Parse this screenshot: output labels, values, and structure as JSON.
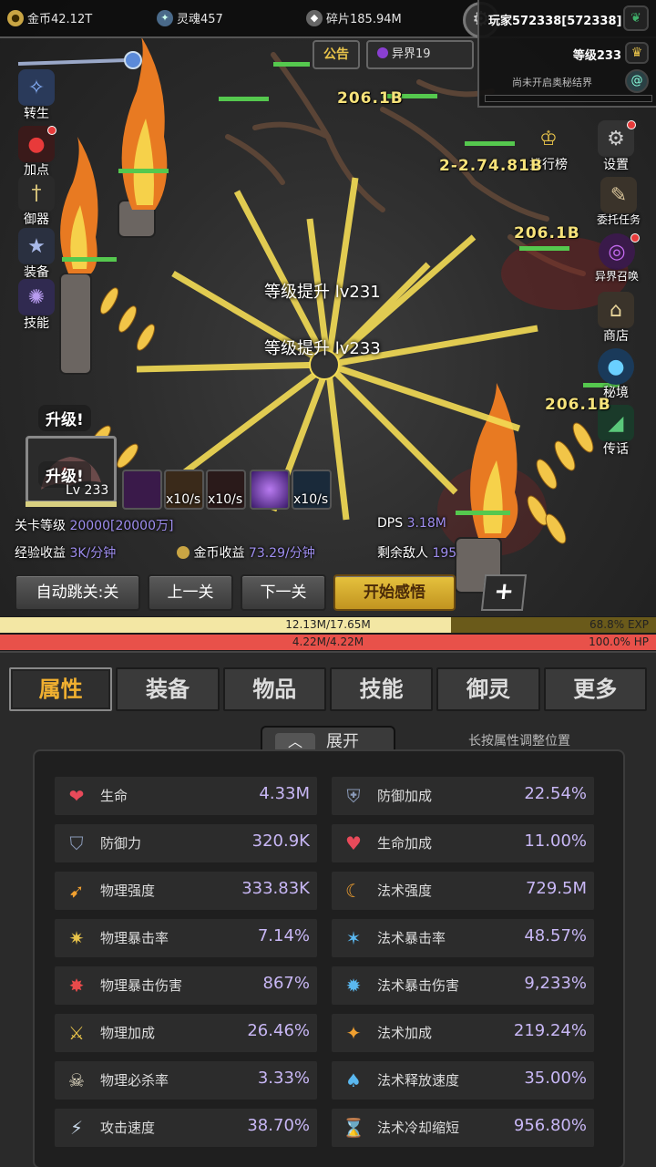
{
  "resources": {
    "gold": "金币42.12T",
    "soul": "灵魂457",
    "shards": "碎片185.94M"
  },
  "player": {
    "name": "玩家572338[572338]",
    "level": "等级233",
    "secret_realm": "尚未开启奥秘结界"
  },
  "notice_label": "公告",
  "realm_label": "异界19",
  "left_menu": [
    {
      "label": "转生",
      "icon": "rebirth-icon"
    },
    {
      "label": "加点",
      "icon": "blood-drop-icon"
    },
    {
      "label": "御器",
      "icon": "sword-icon"
    },
    {
      "label": "装备",
      "icon": "star-badge-icon"
    },
    {
      "label": "技能",
      "icon": "spellbook-icon"
    }
  ],
  "right_menu": [
    {
      "label": "排行榜",
      "icon": "trophy-icon"
    },
    {
      "label": "设置",
      "icon": "gear-icon"
    },
    {
      "label": "委托任务",
      "icon": "scroll-icon"
    },
    {
      "label": "异界召唤",
      "icon": "portal-icon"
    },
    {
      "label": "商店",
      "icon": "shop-bag-icon"
    },
    {
      "label": "秘境",
      "icon": "orb-icon"
    },
    {
      "label": "传话",
      "icon": "horn-icon"
    }
  ],
  "level_up_messages": [
    "等级提升 lv231",
    "等级提升 lv233"
  ],
  "floating_numbers": [
    "206.1B",
    "2-2.74.81B",
    "206.1B",
    "206.1B"
  ],
  "character": {
    "level": "Lv 233",
    "upgrade_1": "升级!",
    "upgrade_2": "升级!"
  },
  "skill_rates": [
    "x10/s",
    "x10/s",
    "x10/s"
  ],
  "stage_info": {
    "stage_label": "关卡等级",
    "stage_value": "20000[20000万]",
    "dps_label": "DPS",
    "dps_value": "3.18M",
    "exp_label": "经验收益",
    "exp_value": "3K/分钟",
    "gold_label": "金币收益",
    "gold_value": "73.29/分钟",
    "enemies_label": "剩余敌人",
    "enemies_value": "195"
  },
  "buttons": {
    "auto_skip": "自动跳关:关",
    "prev": "上一关",
    "next": "下一关",
    "start": "开始感悟",
    "plus": "+"
  },
  "exp_bar": {
    "text": "12.13M/17.65M",
    "percent": "68.8% EXP",
    "fill": 0.688
  },
  "hp_bar": {
    "text": "4.22M/4.22M",
    "percent": "100.0% HP",
    "fill": 1.0
  },
  "tabs": [
    "属性",
    "装备",
    "物品",
    "技能",
    "御灵",
    "更多"
  ],
  "expand_label": "展开",
  "hint": "长按属性调整位置",
  "stats": [
    {
      "name": "生命",
      "value": "4.33M",
      "icon": "heart-icon"
    },
    {
      "name": "防御加成",
      "value": "22.54%",
      "icon": "shield-plus-icon"
    },
    {
      "name": "防御力",
      "value": "320.9K",
      "icon": "shield-icon"
    },
    {
      "name": "生命加成",
      "value": "11.00%",
      "icon": "heart-plus-icon"
    },
    {
      "name": "物理强度",
      "value": "333.83K",
      "icon": "spear-icon"
    },
    {
      "name": "法术强度",
      "value": "729.5M",
      "icon": "moon-staff-icon"
    },
    {
      "name": "物理暴击率",
      "value": "7.14%",
      "icon": "crit-sword-icon"
    },
    {
      "name": "法术暴击率",
      "value": "48.57%",
      "icon": "crit-magic-icon"
    },
    {
      "name": "物理暴击伤害",
      "value": "867%",
      "icon": "crit-damage-icon"
    },
    {
      "name": "法术暴击伤害",
      "value": "9,233%",
      "icon": "magic-damage-icon"
    },
    {
      "name": "物理加成",
      "value": "26.46%",
      "icon": "sword-plus-icon"
    },
    {
      "name": "法术加成",
      "value": "219.24%",
      "icon": "magic-plus-icon"
    },
    {
      "name": "物理必杀率",
      "value": "3.33%",
      "icon": "skull-icon"
    },
    {
      "name": "法术释放速度",
      "value": "35.00%",
      "icon": "mushroom-icon"
    },
    {
      "name": "攻击速度",
      "value": "38.70%",
      "icon": "speed-sword-icon"
    },
    {
      "name": "法术冷却缩短",
      "value": "956.80%",
      "icon": "hourglass-icon"
    }
  ]
}
